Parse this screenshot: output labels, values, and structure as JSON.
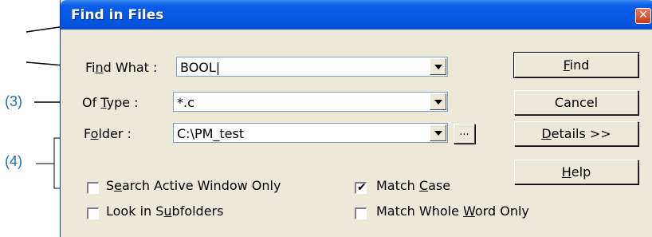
{
  "annotations": {
    "label_3": "(3)",
    "label_4": "(4)"
  },
  "dialog": {
    "title": "Find in Files",
    "close_icon": "close-x-icon",
    "find_what": {
      "label_pre": "Fi",
      "label_key": "n",
      "label_post": "d What :",
      "value": "BOOL|"
    },
    "of_type": {
      "label_pre": "Of ",
      "label_key": "T",
      "label_post": "ype :",
      "value": "*.c"
    },
    "folder": {
      "label_pre": "F",
      "label_key": "o",
      "label_post": "lder :",
      "value": "C:\\PM_test",
      "browse_label": "..."
    },
    "buttons": {
      "find_key": "F",
      "find_rest": "ind",
      "cancel": "Cancel",
      "details_key": "D",
      "details_rest": "etails >>",
      "help_key": "H",
      "help_rest": "elp"
    },
    "options": {
      "search_active_pre": "S",
      "search_active_key": "e",
      "search_active_post": "arch Active Window Only",
      "search_active_checked": false,
      "subfolders_pre": "Look in S",
      "subfolders_key": "u",
      "subfolders_post": "bfolders",
      "subfolders_checked": false,
      "match_case_pre": "Match ",
      "match_case_key": "C",
      "match_case_post": "ase",
      "match_case_checked": true,
      "whole_word_pre": "Match Whole ",
      "whole_word_key": "W",
      "whole_word_post": "ord Only",
      "whole_word_checked": false
    }
  },
  "colors": {
    "title_bar": "#0458e4",
    "dialog_bg": "#ece9d8",
    "annotation": "#1f6fb8"
  }
}
